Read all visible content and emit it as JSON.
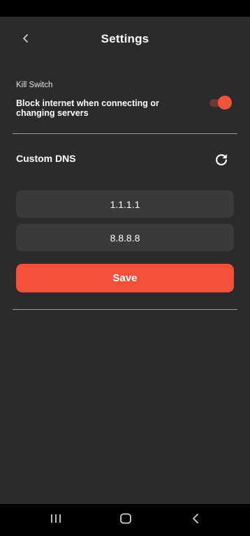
{
  "header": {
    "title": "Settings",
    "back_icon": "chevron-left-icon"
  },
  "kill_switch": {
    "section_label": "Kill Switch",
    "description": "Block internet when connecting or changing servers",
    "enabled": true,
    "accent_color": "#f0553b"
  },
  "custom_dns": {
    "title": "Custom DNS",
    "refresh_icon": "refresh-icon",
    "primary_dns": "1.1.1.1",
    "secondary_dns": "8.8.8.8",
    "save_label": "Save",
    "save_color": "#f4513a"
  },
  "nav_bar": {
    "recents_icon": "recents-icon",
    "home_icon": "home-icon",
    "back_icon": "back-icon"
  },
  "colors": {
    "background": "#2b2b2d",
    "field_background": "#3a3a3d",
    "divider": "#9a9a9a"
  }
}
